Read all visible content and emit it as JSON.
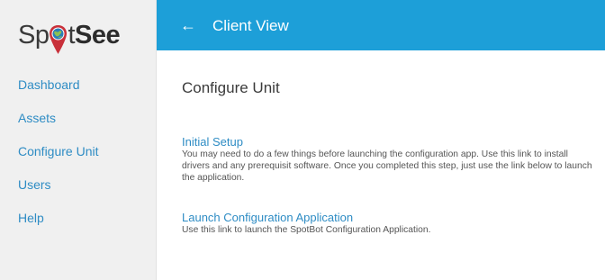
{
  "brand": {
    "name_part1": "Sp",
    "name_part2": "t",
    "name_bold": "See",
    "pin_color": "#c8303a",
    "globe_color": "#2a7fb8"
  },
  "sidebar": {
    "items": [
      {
        "label": "Dashboard"
      },
      {
        "label": "Assets"
      },
      {
        "label": "Configure Unit"
      },
      {
        "label": "Users"
      },
      {
        "label": "Help"
      }
    ]
  },
  "header": {
    "back_icon": "arrow-left-icon",
    "back_glyph": "←",
    "title": "Client View",
    "background": "#1d9fd8"
  },
  "main": {
    "page_title": "Configure Unit",
    "sections": [
      {
        "link": "Initial Setup",
        "description": "You may need to do a few things before launching the configuration app. Use this link to install drivers and any prerequisit software. Once you completed this step, just use the link below to launch the application."
      },
      {
        "link": "Launch Configuration Application",
        "description": "Use this link to launch the SpotBot Configuration Application."
      }
    ]
  },
  "colors": {
    "accent": "#1d9fd8",
    "link": "#2e8cc4",
    "sidebar_bg": "#f0f0f0"
  }
}
